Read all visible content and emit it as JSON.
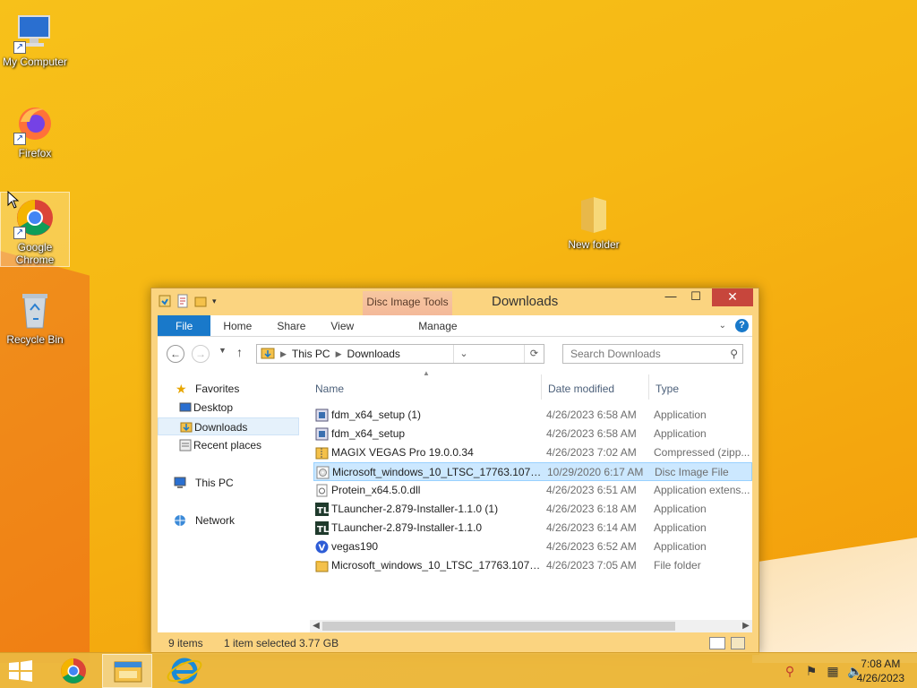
{
  "desktop": {
    "icons": [
      {
        "label": "My Computer"
      },
      {
        "label": "Firefox"
      },
      {
        "label": "Google Chrome"
      },
      {
        "label": "Recycle Bin"
      },
      {
        "label": "New folder"
      }
    ]
  },
  "window": {
    "title": "Downloads",
    "context_tab": "Disc Image Tools",
    "ribbon": {
      "tabs": [
        "File",
        "Home",
        "Share",
        "View",
        "Manage"
      ]
    },
    "address": {
      "segments": [
        "This PC",
        "Downloads"
      ]
    },
    "search": {
      "placeholder": "Search Downloads"
    },
    "nav": {
      "favorites": "Favorites",
      "desktop": "Desktop",
      "downloads": "Downloads",
      "recent": "Recent places",
      "thispc": "This PC",
      "network": "Network"
    },
    "columns": {
      "name": "Name",
      "date": "Date modified",
      "type": "Type"
    },
    "files": [
      {
        "name": "fdm_x64_setup (1)",
        "date": "4/26/2023 6:58 AM",
        "type": "Application",
        "icon": "setup-icon"
      },
      {
        "name": "fdm_x64_setup",
        "date": "4/26/2023 6:58 AM",
        "type": "Application",
        "icon": "setup-icon"
      },
      {
        "name": "MAGIX VEGAS Pro 19.0.0.34",
        "date": "4/26/2023 7:02 AM",
        "type": "Compressed (zipp...",
        "icon": "zip-icon"
      },
      {
        "name": "Microsoft_windows_10_LTSC_17763.107.1...",
        "date": "10/29/2020 6:17 AM",
        "type": "Disc Image File",
        "icon": "disc-image-icon"
      },
      {
        "name": "Protein_x64.5.0.dll",
        "date": "4/26/2023 6:51 AM",
        "type": "Application extens...",
        "icon": "dll-icon"
      },
      {
        "name": "TLauncher-2.879-Installer-1.1.0 (1)",
        "date": "4/26/2023 6:18 AM",
        "type": "Application",
        "icon": "tlauncher-icon"
      },
      {
        "name": "TLauncher-2.879-Installer-1.1.0",
        "date": "4/26/2023 6:14 AM",
        "type": "Application",
        "icon": "tlauncher-icon"
      },
      {
        "name": "vegas190",
        "date": "4/26/2023 6:52 AM",
        "type": "Application",
        "icon": "vegas-icon"
      },
      {
        "name": "Microsoft_windows_10_LTSC_17763.107.1...",
        "date": "4/26/2023 7:05 AM",
        "type": "File folder",
        "icon": "folder-icon"
      }
    ],
    "selected_index": 3,
    "status": {
      "items": "9 items",
      "selection": "1 item selected  3.77 GB"
    }
  },
  "taskbar": {
    "clock_time": "7:08 AM",
    "clock_date": "4/26/2023"
  },
  "colors": {
    "accent": "#1979ca",
    "close": "#c7463c",
    "selection": "#cce8ff"
  }
}
